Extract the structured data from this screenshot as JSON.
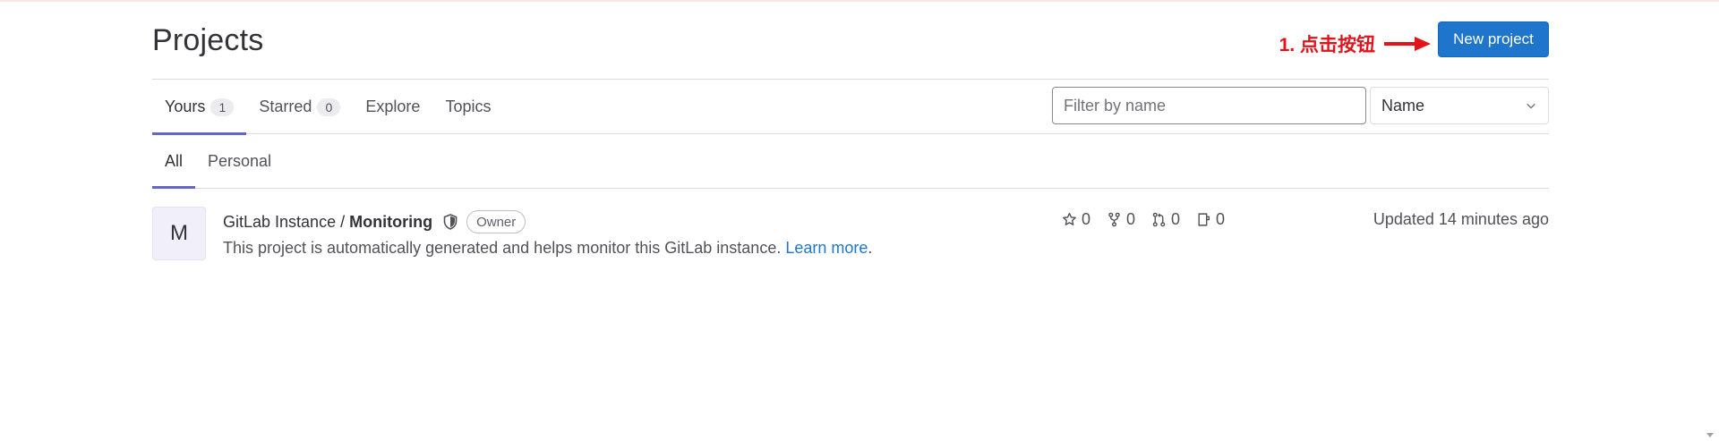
{
  "header": {
    "title": "Projects",
    "annotation": "1. 点击按钮",
    "new_project_label": "New project"
  },
  "tabs": [
    {
      "label": "Yours",
      "count": "1"
    },
    {
      "label": "Starred",
      "count": "0"
    },
    {
      "label": "Explore"
    },
    {
      "label": "Topics"
    }
  ],
  "filter": {
    "placeholder": "Filter by name"
  },
  "sort": {
    "selected": "Name"
  },
  "subtabs": [
    {
      "label": "All"
    },
    {
      "label": "Personal"
    }
  ],
  "project": {
    "avatar_letter": "M",
    "namespace": "GitLab Instance",
    "separator": "/",
    "name": "Monitoring",
    "role": "Owner",
    "description": "This project is automatically generated and helps monitor this GitLab instance.",
    "learn_more": "Learn more",
    "period": ".",
    "stars": "0",
    "forks": "0",
    "merge_requests": "0",
    "issues": "0",
    "updated": "Updated 14 minutes ago"
  },
  "colors": {
    "accent": "#1f75cb",
    "tab_indicator": "#6666c4",
    "annotation": "#e3131b"
  },
  "icons": [
    "chevron-down-icon",
    "shield-icon",
    "star-icon",
    "fork-icon",
    "merge-request-icon",
    "issues-icon",
    "arrow-right-icon"
  ]
}
